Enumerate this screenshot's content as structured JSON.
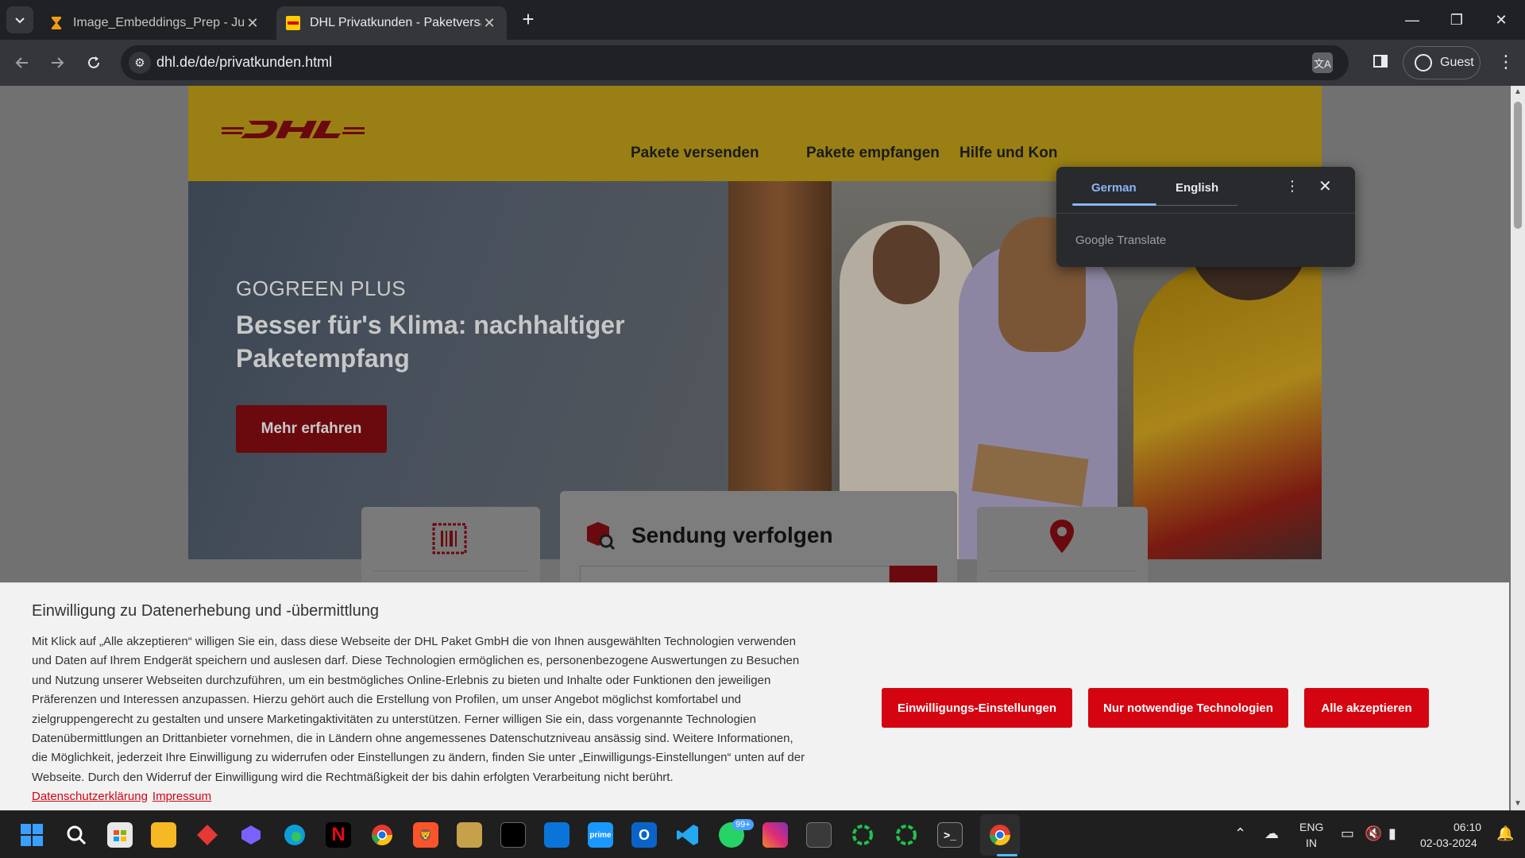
{
  "browser": {
    "tabs": [
      {
        "title": "Image_Embeddings_Prep - Jupy",
        "active": false,
        "icon": "hourglass-icon"
      },
      {
        "title": "DHL Privatkunden - Paketversan",
        "active": true,
        "icon": "dhl-favicon"
      }
    ],
    "new_tab": "+",
    "url": "dhl.de/de/privatkunden.html",
    "profile_label": "Guest"
  },
  "translate_popup": {
    "tab_source": "German",
    "tab_target": "English",
    "brand": "Google Translate"
  },
  "page": {
    "nav": [
      "Pakete versenden",
      "Pakete empfangen",
      "Hilfe und Kon"
    ],
    "hero": {
      "kicker": "GOGREEN PLUS",
      "title": "Besser für's Klima: nachhaltiger Paketempfang",
      "button": "Mehr erfahren"
    },
    "tracking": {
      "title": "Sendung verfolgen"
    }
  },
  "cookie_banner": {
    "title": "Einwilligung zu Datenerhebung und -übermittlung",
    "text": "Mit Klick auf „Alle akzeptieren“ willigen Sie ein, dass diese Webseite der DHL Paket GmbH die von Ihnen ausgewählten Technologien verwenden und Daten auf Ihrem Endgerät speichern und auslesen darf. Diese Technologien ermöglichen es, personenbezogene Auswertungen zu Besuchen und Nutzung unserer Webseiten durchzuführen, um ein bestmögliches Online-Erlebnis zu bieten und Inhalte oder Funktionen den jeweiligen Präferenzen und Interessen anzupassen. Hierzu gehört auch die Erstellung von Profilen, um unser Angebot möglichst komfortabel und zielgruppengerecht zu gestalten und unsere Marketingaktivitäten zu unterstützen. Ferner willigen Sie ein, dass vorgenannte Technologien Datenübermittlungen an Drittanbieter vornehmen, die in Ländern ohne angemessenes Datenschutzniveau ansässig sind. Weitere Informationen, die Möglichkeit, jederzeit Ihre Einwilligung zu widerrufen oder Einstellungen zu ändern, finden Sie unter „Einwilligungs-Einstellungen“ unten auf der Webseite. Durch den Widerruf der Einwilligung wird die Rechtmäßigkeit der bis dahin erfolgten Verarbeitung nicht berührt.",
    "link_privacy": "Datenschutzerklärung",
    "link_imprint": "Impressum",
    "btn_settings": "Einwilligungs-Einstellungen",
    "btn_necessary": "Nur notwendige Technologien",
    "btn_accept": "Alle akzeptieren"
  },
  "taskbar": {
    "whatsapp_badge": "99+",
    "lang_top": "ENG",
    "lang_bottom": "IN",
    "time": "06:10",
    "date": "02-03-2024"
  },
  "colors": {
    "dhl_yellow": "#9a8014",
    "dhl_red": "#d40511",
    "chrome_dark": "#202124",
    "chrome_toolbar": "#35363a",
    "translate_accent": "#8ab4f8"
  }
}
